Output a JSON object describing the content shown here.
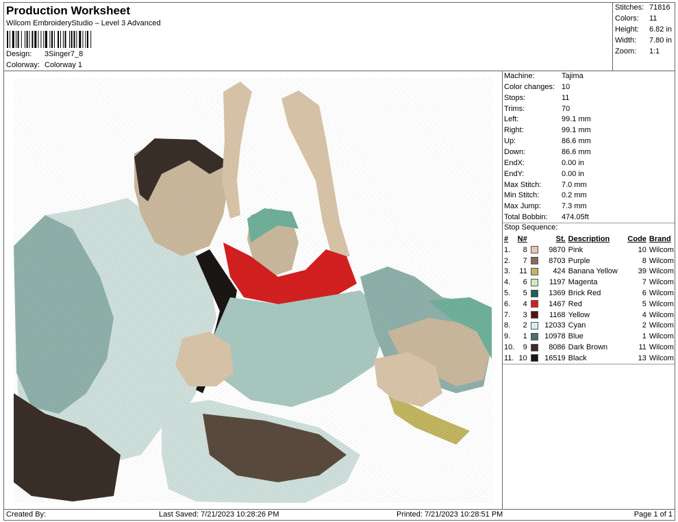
{
  "header": {
    "title": "Production Worksheet",
    "subtitle": "Wilcom EmbroideryStudio – Level 3 Advanced",
    "design_label": "Design:",
    "design_value": "3Singer7_8",
    "colorway_label": "Colorway:",
    "colorway_value": "Colorway 1"
  },
  "summary": {
    "stitches_label": "Stitches:",
    "stitches_value": "71816",
    "colors_label": "Colors:",
    "colors_value": "11",
    "height_label": "Height:",
    "height_value": "6.82 in",
    "width_label": "Width:",
    "width_value": "7.80 in",
    "zoom_label": "Zoom:",
    "zoom_value": "1:1"
  },
  "machine_info": [
    {
      "k": "Machine:",
      "v": "Tajima"
    },
    {
      "k": "Color changes:",
      "v": "10"
    },
    {
      "k": "Stops:",
      "v": "11"
    },
    {
      "k": "Trims:",
      "v": "70"
    },
    {
      "k": "Left:",
      "v": "99.1 mm"
    },
    {
      "k": "Right:",
      "v": "99.1 mm"
    },
    {
      "k": "Up:",
      "v": "86.6 mm"
    },
    {
      "k": "Down:",
      "v": "86.6 mm"
    },
    {
      "k": "EndX:",
      "v": "0.00 in"
    },
    {
      "k": "EndY:",
      "v": "0.00 in"
    },
    {
      "k": "Max Stitch:",
      "v": "7.0 mm"
    },
    {
      "k": "Min Stitch:",
      "v": "0.2 mm"
    },
    {
      "k": "Max Jump:",
      "v": "7.3 mm"
    },
    {
      "k": "Total Bobbin:",
      "v": "474.05ft"
    }
  ],
  "stop_sequence": {
    "title": "Stop Sequence:",
    "headers": [
      "#",
      "N#",
      "St.",
      "Description",
      "Code",
      "Brand"
    ],
    "rows": [
      {
        "num": "1.",
        "n": "8",
        "color": "#e8c4b0",
        "st": "9870",
        "desc": "Pink",
        "code": "10",
        "brand": "Wilcom"
      },
      {
        "num": "2.",
        "n": "7",
        "color": "#8a6a5a",
        "st": "8703",
        "desc": "Purple",
        "code": "8",
        "brand": "Wilcom"
      },
      {
        "num": "3.",
        "n": "11",
        "color": "#c2b561",
        "st": "424",
        "desc": "Banana Yellow",
        "code": "39",
        "brand": "Wilcom"
      },
      {
        "num": "4.",
        "n": "6",
        "color": "#c8ecc0",
        "st": "1197",
        "desc": "Magenta",
        "code": "7",
        "brand": "Wilcom"
      },
      {
        "num": "5.",
        "n": "5",
        "color": "#1f5f5a",
        "st": "1369",
        "desc": "Brick Red",
        "code": "6",
        "brand": "Wilcom"
      },
      {
        "num": "6.",
        "n": "4",
        "color": "#d42020",
        "st": "1467",
        "desc": "Red",
        "code": "5",
        "brand": "Wilcom"
      },
      {
        "num": "7.",
        "n": "3",
        "color": "#5a1010",
        "st": "1168",
        "desc": "Yellow",
        "code": "4",
        "brand": "Wilcom"
      },
      {
        "num": "8.",
        "n": "2",
        "color": "#d8ecf2",
        "st": "12033",
        "desc": "Cyan",
        "code": "2",
        "brand": "Wilcom"
      },
      {
        "num": "9.",
        "n": "1",
        "color": "#4a7068",
        "st": "10978",
        "desc": "Blue",
        "code": "1",
        "brand": "Wilcom"
      },
      {
        "num": "10.",
        "n": "9",
        "color": "#3a2e28",
        "st": "8086",
        "desc": "Dark Brown",
        "code": "11",
        "brand": "Wilcom"
      },
      {
        "num": "11.",
        "n": "10",
        "color": "#1a1614",
        "st": "16519",
        "desc": "Black",
        "code": "13",
        "brand": "Wilcom"
      }
    ]
  },
  "footer": {
    "created_by": "Created By:",
    "last_saved": "Last Saved: 7/21/2023 10:28:26 PM",
    "printed": "Printed: 7/21/2023 10:28:51 PM",
    "page": "Page 1 of 1"
  }
}
